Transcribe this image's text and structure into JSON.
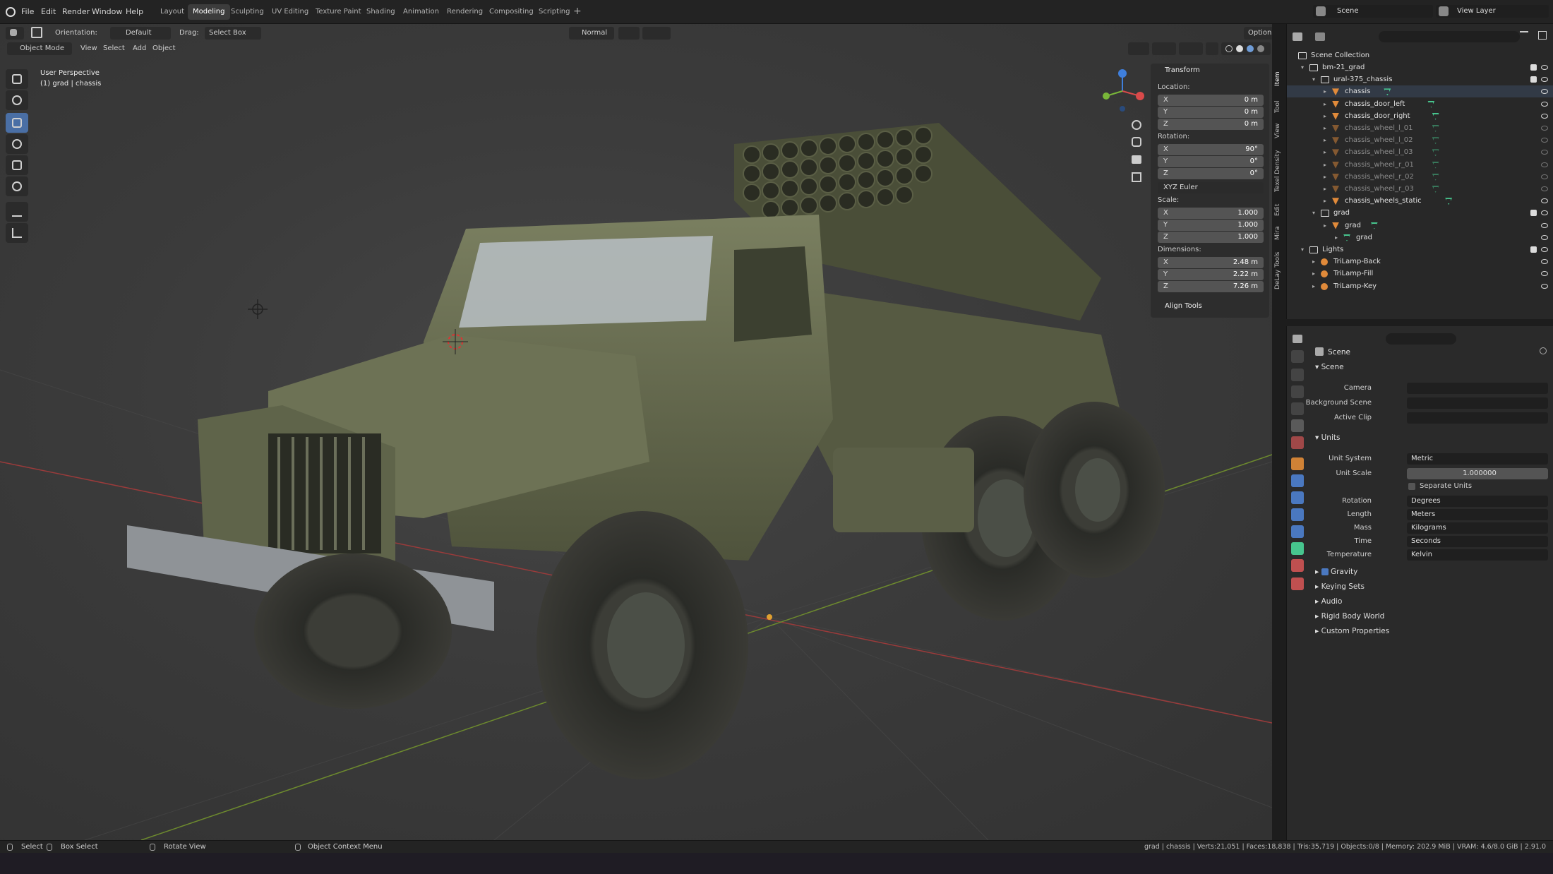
{
  "menu": [
    "File",
    "Edit",
    "Render",
    "Window",
    "Help"
  ],
  "workspaces": [
    "Layout",
    "Modeling",
    "Sculpting",
    "UV Editing",
    "Texture Paint",
    "Shading",
    "Animation",
    "Rendering",
    "Compositing",
    "Scripting"
  ],
  "active_workspace": "Modeling",
  "scene_name": "Scene",
  "view_layer": "View Layer",
  "header": {
    "orientation_label": "Orientation:",
    "orientation_value": "Default",
    "drag_label": "Drag:",
    "drag_value": "Select Box",
    "pivot": "Normal",
    "options": "Options",
    "mode": "Object Mode",
    "view": "View",
    "select": "Select",
    "add": "Add",
    "object": "Object"
  },
  "viewport": {
    "perspective": "User Perspective",
    "active_object": "(1) grad | chassis"
  },
  "transform_panel": {
    "title": "Transform",
    "location_label": "Location:",
    "location": [
      {
        "k": "X",
        "v": "0 m"
      },
      {
        "k": "Y",
        "v": "0 m"
      },
      {
        "k": "Z",
        "v": "0 m"
      }
    ],
    "rotation_label": "Rotation:",
    "rotation": [
      {
        "k": "X",
        "v": "90°"
      },
      {
        "k": "Y",
        "v": "0°"
      },
      {
        "k": "Z",
        "v": "0°"
      }
    ],
    "rotation_mode": "XYZ Euler",
    "scale_label": "Scale:",
    "scale": [
      {
        "k": "X",
        "v": "1.000"
      },
      {
        "k": "Y",
        "v": "1.000"
      },
      {
        "k": "Z",
        "v": "1.000"
      }
    ],
    "dimensions_label": "Dimensions:",
    "dimensions": [
      {
        "k": "X",
        "v": "2.48 m"
      },
      {
        "k": "Y",
        "v": "2.22 m"
      },
      {
        "k": "Z",
        "v": "7.26 m"
      }
    ],
    "align_tools": "Align Tools"
  },
  "side_tabs": [
    "Item",
    "Tool",
    "View",
    "Texel Density",
    "Edit",
    "Mira",
    "DeLay Tools"
  ],
  "outliner": {
    "root": "Scene Collection",
    "rows": [
      {
        "label": "bm-21_grad",
        "depth": 1,
        "type": "collection",
        "dim": false
      },
      {
        "label": "ural-375_chassis",
        "depth": 2,
        "type": "collection",
        "dim": false
      },
      {
        "label": "chassis",
        "depth": 3,
        "type": "object",
        "dim": false
      },
      {
        "label": "chassis_door_left",
        "depth": 3,
        "type": "object",
        "dim": false
      },
      {
        "label": "chassis_door_right",
        "depth": 3,
        "type": "object",
        "dim": false
      },
      {
        "label": "chassis_wheel_l_01",
        "depth": 3,
        "type": "object",
        "dim": true
      },
      {
        "label": "chassis_wheel_l_02",
        "depth": 3,
        "type": "object",
        "dim": true
      },
      {
        "label": "chassis_wheel_l_03",
        "depth": 3,
        "type": "object",
        "dim": true
      },
      {
        "label": "chassis_wheel_r_01",
        "depth": 3,
        "type": "object",
        "dim": true
      },
      {
        "label": "chassis_wheel_r_02",
        "depth": 3,
        "type": "object",
        "dim": true
      },
      {
        "label": "chassis_wheel_r_03",
        "depth": 3,
        "type": "object",
        "dim": true
      },
      {
        "label": "chassis_wheels_static",
        "depth": 3,
        "type": "object",
        "dim": false
      },
      {
        "label": "grad",
        "depth": 2,
        "type": "collection",
        "dim": false
      },
      {
        "label": "grad",
        "depth": 3,
        "type": "object",
        "dim": false
      },
      {
        "label": "grad",
        "depth": 4,
        "type": "mesh",
        "dim": false
      },
      {
        "label": "Lights",
        "depth": 1,
        "type": "collection",
        "dim": false
      },
      {
        "label": "TriLamp-Back",
        "depth": 2,
        "type": "light",
        "dim": false
      },
      {
        "label": "TriLamp-Fill",
        "depth": 2,
        "type": "light",
        "dim": false
      },
      {
        "label": "TriLamp-Key",
        "depth": 2,
        "type": "light",
        "dim": false
      }
    ]
  },
  "properties": {
    "context": "Scene",
    "scene_section": "Scene",
    "camera_label": "Camera",
    "background_scene_label": "Background Scene",
    "active_clip_label": "Active Clip",
    "units_section": "Units",
    "unit_system_label": "Unit System",
    "unit_system": "Metric",
    "unit_scale_label": "Unit Scale",
    "unit_scale": "1.000000",
    "separate_units": "Separate Units",
    "rotation_label": "Rotation",
    "rotation": "Degrees",
    "length_label": "Length",
    "length": "Meters",
    "mass_label": "Mass",
    "mass": "Kilograms",
    "time_label": "Time",
    "time": "Seconds",
    "temperature_label": "Temperature",
    "temperature": "Kelvin",
    "collapsed": [
      "Gravity",
      "Keying Sets",
      "Audio",
      "Rigid Body World",
      "Custom Properties"
    ]
  },
  "status": {
    "select": "Select",
    "box_select": "Box Select",
    "rotate_view": "Rotate View",
    "context_menu": "Object Context Menu",
    "stats": "grad | chassis | Verts:21,051 | Faces:18,838 | Tris:35,719 | Objects:0/8 | Memory: 202.9 MiB | VRAM: 4.6/8.0 GiB | 2.91.0"
  },
  "colors": {
    "accent": "#4a6fa5",
    "object_orange": "#e08a3a",
    "mesh_green": "#47c58e"
  }
}
